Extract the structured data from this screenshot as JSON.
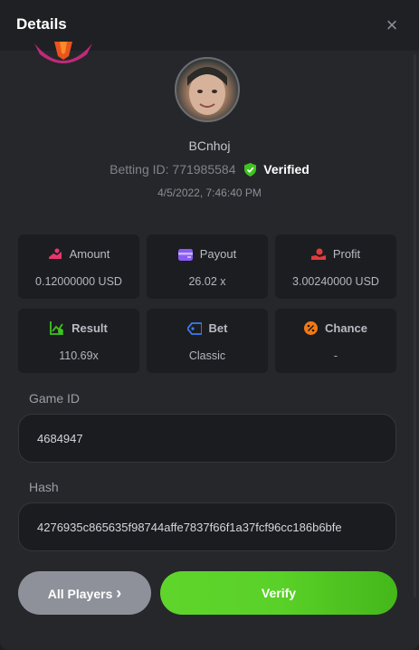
{
  "header": {
    "title": "Details",
    "close_glyph": "×"
  },
  "player": {
    "username": "BCnhoj",
    "betting_id_label": "Betting ID:",
    "betting_id": "771985584",
    "verified_label": "Verified",
    "datetime": "4/5/2022, 7:46:40 PM"
  },
  "stats": [
    {
      "icon": "coins-hand-icon",
      "label": "Amount",
      "value": "0.12000000 USD",
      "color": "#e8366e"
    },
    {
      "icon": "wallet-icon",
      "label": "Payout",
      "value": "26.02 x",
      "color": "#8a5cf6"
    },
    {
      "icon": "profit-hand-icon",
      "label": "Profit",
      "value": "3.00240000 USD",
      "color": "#e53a3a"
    },
    {
      "icon": "chart-up-icon",
      "label": "Result",
      "value": "110.69x",
      "color": "#3fc31f"
    },
    {
      "icon": "tag-icon",
      "label": "Bet",
      "value": "Classic",
      "color": "#3b7cf0"
    },
    {
      "icon": "percent-icon",
      "label": "Chance",
      "value": "-",
      "color": "#f07a16"
    }
  ],
  "game_id": {
    "label": "Game ID",
    "value": "4684947"
  },
  "hash": {
    "label": "Hash",
    "value": "4276935c865635f98744affe7837f66f1a37fcf96cc186b6bfe"
  },
  "buttons": {
    "all_players": "All Players",
    "all_players_chevron": "›",
    "verify": "Verify"
  },
  "colors": {
    "verify_green": "#5ad128",
    "verified_shield": "#3fc31f"
  }
}
